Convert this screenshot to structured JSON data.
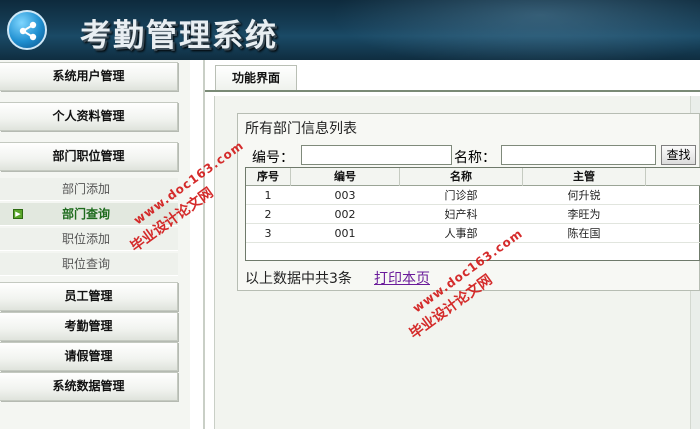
{
  "app": {
    "title": "考勤管理系统"
  },
  "sidebar": {
    "menu": [
      {
        "label": "系统用户管理"
      },
      {
        "label": "个人资料管理"
      },
      {
        "label": "部门职位管理"
      },
      {
        "label": "员工管理"
      },
      {
        "label": "考勤管理"
      },
      {
        "label": "请假管理"
      },
      {
        "label": "系统数据管理"
      }
    ],
    "submenu": [
      {
        "label": "部门添加",
        "active": false
      },
      {
        "label": "部门查询",
        "active": true
      },
      {
        "label": "职位添加",
        "active": false
      },
      {
        "label": "职位查询",
        "active": false
      }
    ]
  },
  "tab": {
    "label": "功能界面"
  },
  "panel": {
    "title": "所有部门信息列表",
    "search": {
      "no_label": "编号：",
      "name_label": "名称：",
      "no_value": "",
      "name_value": "",
      "button_label": "查找"
    },
    "table": {
      "columns": [
        "序号",
        "编号",
        "名称",
        "主管"
      ],
      "rows": [
        [
          "1",
          "003",
          "门诊部",
          "何升锐"
        ],
        [
          "2",
          "002",
          "妇产科",
          "李旺为"
        ],
        [
          "3",
          "001",
          "人事部",
          "陈在国"
        ]
      ]
    },
    "summary": "以上数据中共3条",
    "print_link": "打印本页"
  },
  "watermarks": {
    "line1": "毕业设计论文网",
    "line2": "www.doc163.com"
  },
  "colors": {
    "accent_green": "#5aa52a",
    "watermark_red": "#d21a1a",
    "link_purple": "#6a1b9a"
  }
}
